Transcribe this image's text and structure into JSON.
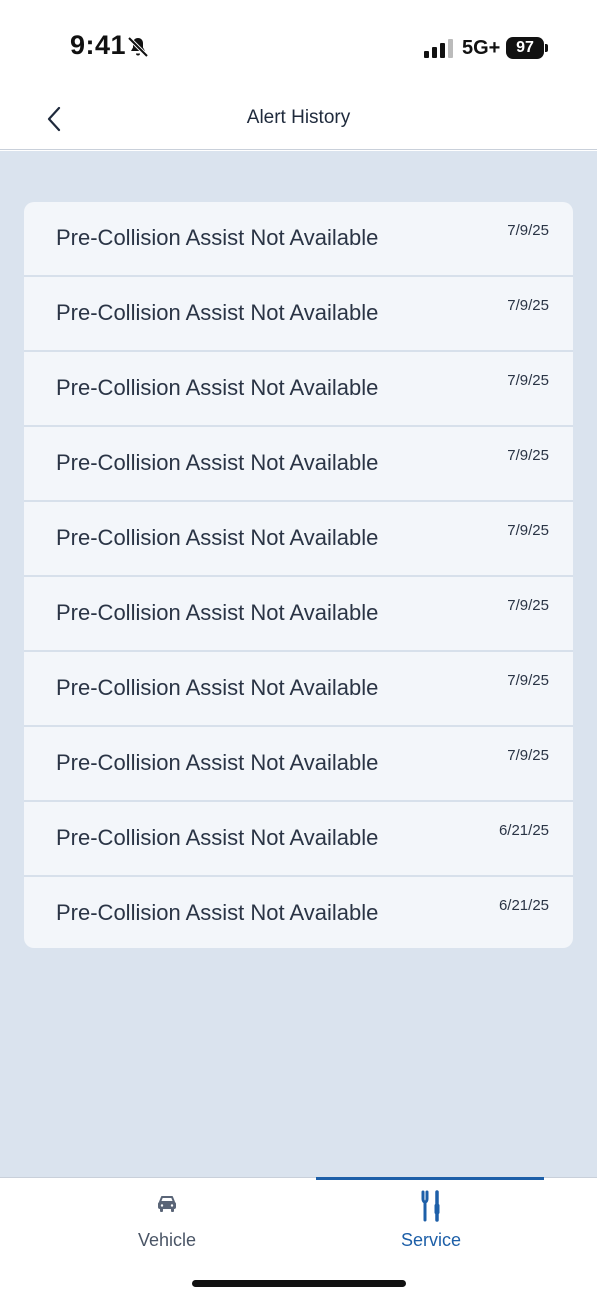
{
  "status_bar": {
    "time": "9:41",
    "network": "5G+",
    "battery": "97",
    "icons": [
      "bell-slash-icon",
      "signal-icon"
    ]
  },
  "header": {
    "title": "Alert History",
    "back_icon": "chevron-left-icon"
  },
  "alerts": [
    {
      "title": "Pre-Collision Assist Not Available",
      "date": "7/9/25"
    },
    {
      "title": "Pre-Collision Assist Not Available",
      "date": "7/9/25"
    },
    {
      "title": "Pre-Collision Assist Not Available",
      "date": "7/9/25"
    },
    {
      "title": "Pre-Collision Assist Not Available",
      "date": "7/9/25"
    },
    {
      "title": "Pre-Collision Assist Not Available",
      "date": "7/9/25"
    },
    {
      "title": "Pre-Collision Assist Not Available",
      "date": "7/9/25"
    },
    {
      "title": "Pre-Collision Assist Not Available",
      "date": "7/9/25"
    },
    {
      "title": "Pre-Collision Assist Not Available",
      "date": "7/9/25"
    },
    {
      "title": "Pre-Collision Assist Not Available",
      "date": "6/21/25"
    },
    {
      "title": "Pre-Collision Assist Not Available",
      "date": "6/21/25"
    }
  ],
  "tab_bar": {
    "tabs": [
      {
        "label": "Vehicle",
        "icon": "car-icon",
        "active": false
      },
      {
        "label": "Service",
        "icon": "tools-icon",
        "active": true
      }
    ]
  },
  "colors": {
    "accent": "#1d5fa8",
    "content_background": "#dae3ee",
    "card_background": "#f3f6fa"
  }
}
